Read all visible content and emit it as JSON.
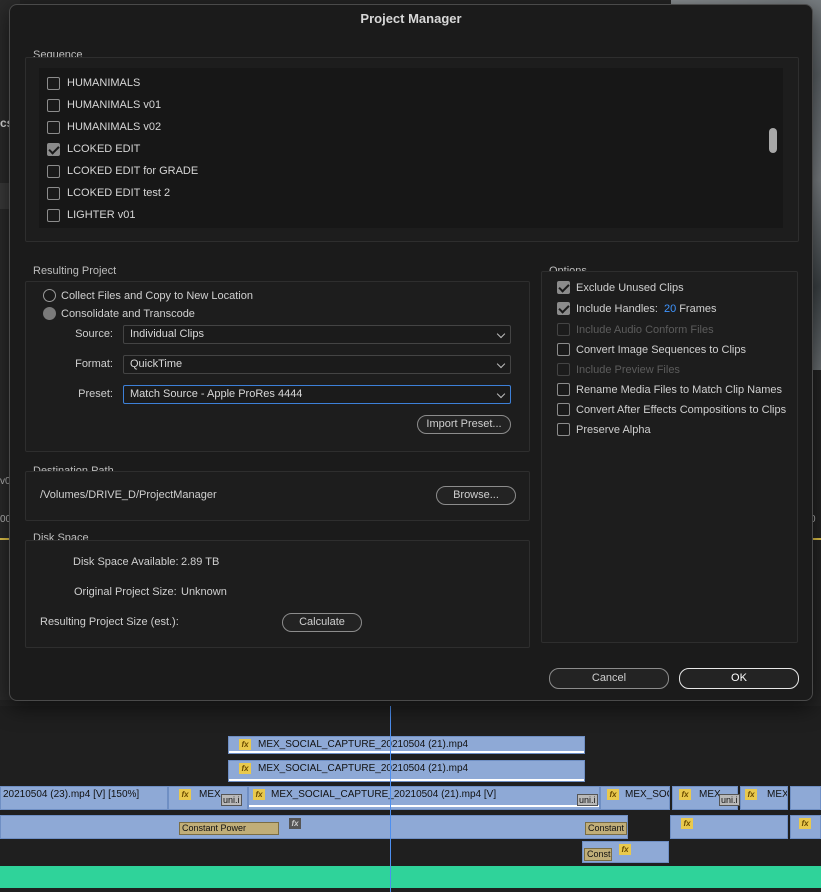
{
  "background": {
    "left_text": "cs",
    "left_v0": "v0",
    "left_ruler": "00",
    "right_ruler": "0",
    "timeline": {
      "track1_label": "MEX_SOCIAL_CAPTURE_20210504 (21).mp4",
      "track2_label": "MEX_SOCIAL_CAPTURE_20210504 (21).mp4",
      "track3_left_label": "20210504 (23).mp4 [V] [150%]",
      "track3_mex1": "MEX",
      "track3_main_label": "MEX_SOCIAL_CAPTURE_20210504 (21).mp4 [V]",
      "track3_mex_soc": "MEX_SOC",
      "track3_mex2": "MEX",
      "track3_mex3": "MEX",
      "unit_labels": [
        "uni.i",
        "uni.i",
        "uni.i"
      ],
      "constant_power": "Constant Power",
      "constant": "Constant",
      "const": "Const",
      "fx_label": "fx"
    }
  },
  "dialog": {
    "title": "Project Manager",
    "sequence": {
      "label": "Sequence",
      "items": [
        {
          "label": "HUMANIMALS",
          "checked": false
        },
        {
          "label": "HUMANIMALS v01",
          "checked": false
        },
        {
          "label": "HUMANIMALS v02",
          "checked": false
        },
        {
          "label": "LCOKED EDIT",
          "checked": true
        },
        {
          "label": "LCOKED EDIT for GRADE",
          "checked": false
        },
        {
          "label": "LCOKED EDIT test 2",
          "checked": false
        },
        {
          "label": "LIGHTER v01",
          "checked": false
        }
      ]
    },
    "resulting_project": {
      "label": "Resulting Project",
      "radio_collect": "Collect Files and Copy to New Location",
      "radio_consolidate": "Consolidate and Transcode",
      "selected": "Consolidate and Transcode",
      "source_label": "Source:",
      "source_value": "Individual Clips",
      "format_label": "Format:",
      "format_value": "QuickTime",
      "preset_label": "Preset:",
      "preset_value": "Match Source - Apple ProRes 4444",
      "import_preset_button": "Import Preset..."
    },
    "destination": {
      "label": "Destination Path",
      "path": "/Volumes/DRIVE_D/ProjectManager",
      "browse_button": "Browse..."
    },
    "disk_space": {
      "label": "Disk Space",
      "available_label": "Disk Space Available:",
      "available_value": "2.89 TB",
      "original_label": "Original Project Size:",
      "original_value": "Unknown",
      "resulting_label": "Resulting Project Size (est.):",
      "calculate_button": "Calculate"
    },
    "options": {
      "label": "Options",
      "exclude_unused": "Exclude Unused Clips",
      "include_handles": "Include Handles:",
      "handles_value": "20",
      "handles_unit": "Frames",
      "include_audio_conform": "Include Audio Conform Files",
      "convert_image_sequences": "Convert Image Sequences to Clips",
      "include_preview": "Include Preview Files",
      "rename_media": "Rename Media Files to Match Clip Names",
      "convert_ae": "Convert After Effects Compositions to Clips",
      "preserve_alpha": "Preserve Alpha"
    },
    "cancel_button": "Cancel",
    "ok_button": "OK"
  },
  "colors": {
    "accent_blue": "#3f95ff",
    "focus_border": "#3d80d8",
    "clip_blue": "#8ea9d6",
    "audio_green": "#2fd39a",
    "fx_yellow": "#e9c94d"
  }
}
